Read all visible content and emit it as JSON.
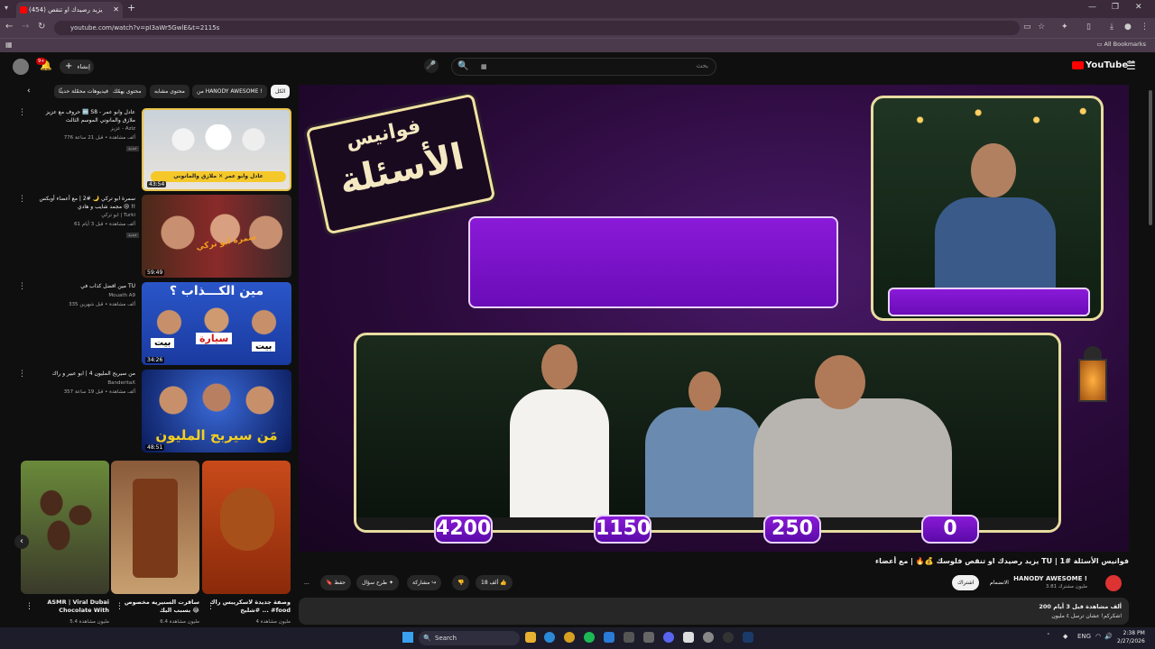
{
  "browser": {
    "tab_title": "(454) يزيد رصيدك او تنقص",
    "tab_close": "✕",
    "new_tab": "+",
    "url": "youtube.com/watch?v=pI3aWr5GwlE&t=2115s",
    "all_bookmarks": "All Bookmarks"
  },
  "yt_header": {
    "notif_count": "9+",
    "create_label": "إنشاء",
    "search_placeholder": "بحث",
    "logo_text": "YouTube",
    "logo_region": "SA"
  },
  "chips": [
    "الكل",
    "من HANODY AWESOME !",
    "محتوى مشابه",
    "محتوى يهمّك",
    "فيديوهات محمّلة حديثًا"
  ],
  "recommendations": [
    {
      "title": "حروف مع عزيز 🔤 S8 عادل وابو عمر - ملازق والمانوني الموسم الثالث",
      "channel": "عزيز - Aziz",
      "meta": "776 ألف مشاهدة • قبل 21 ساعة",
      "badge": "جديد",
      "duration": "43:54"
    },
    {
      "title": "سمرة ابو تركي 🌙 #2 | مع أعضاء أوبكس مجمد شايب و هادي 😢 !!",
      "channel": "ابو تركي | Turki",
      "meta": "61 ألف مشاهدة • قبل 3 أيام",
      "badge": "جديد",
      "duration": "59:49"
    },
    {
      "title": "مين افضل كذاب في TU",
      "channel": "Mouath A9",
      "meta": "335 ألف مشاهدة • قبل شهرين",
      "badge": "",
      "duration": "34:26"
    },
    {
      "title": "من سيربح المليون 4 | ابو عبير و راك",
      "channel": "BanderitaX",
      "meta": "357 ألف مشاهدة • قبل 19 ساعة",
      "badge": "",
      "duration": "48:51"
    }
  ],
  "thumb_texts": {
    "r1": "عادل وابو عمر ✕ ملازق والمانوني",
    "r2": "سمرة ابو تركي",
    "r3_top": "مين الكـــذاب ؟",
    "r3_a": "بيت",
    "r3_b": "سيارة",
    "r3_c": "بيت",
    "r4": "مَن سيربح المليون"
  },
  "shorts": [
    {
      "title": "ASMR | Viral Dubai Chocolate With",
      "views": "5.4 مليون مشاهدة"
    },
    {
      "title": "ساقرت السنيريه مخصوص بسبب اليك 😂",
      "views": "6.4 مليون مشاهدة"
    },
    {
      "title": "وصفة جديدة لاسكريبس راك ... #شليخ #food",
      "views": "4 مليون مشاهدة"
    }
  ],
  "player": {
    "logo_line1": "فوانيس",
    "logo_line2": "الأسئلة",
    "scores": [
      "4200",
      "1150",
      "250",
      "0"
    ]
  },
  "video": {
    "title": "يزيد رصيدك او تنقص فلوسك 💰🔥 | مع أعضاء TU | فوانيس الأسئلة #1",
    "channel_name": "HANODY AWESOME !",
    "channel_subs": "3.81 مليون مشترك",
    "join_label": "الانضمام",
    "subscribe_label": "اشتراك",
    "like_count": "18 ألف",
    "share_label": "مشاركة",
    "ask_label": "طرح سؤال",
    "save_label": "حفظ",
    "more": "...",
    "desc_line1": "200 ألف مشاهدة  قبل 3 أيام",
    "desc_line2": "اشكركم! عشان ترسل ٤ مليون"
  },
  "taskbar": {
    "search_label": "Search",
    "lang": "ENG",
    "time": "2:38 PM",
    "date": "2/27/2026"
  },
  "colors": {
    "yt_red": "#ff0000",
    "purple_box": "#8a1ad8",
    "gold_border": "#e8dca0"
  }
}
